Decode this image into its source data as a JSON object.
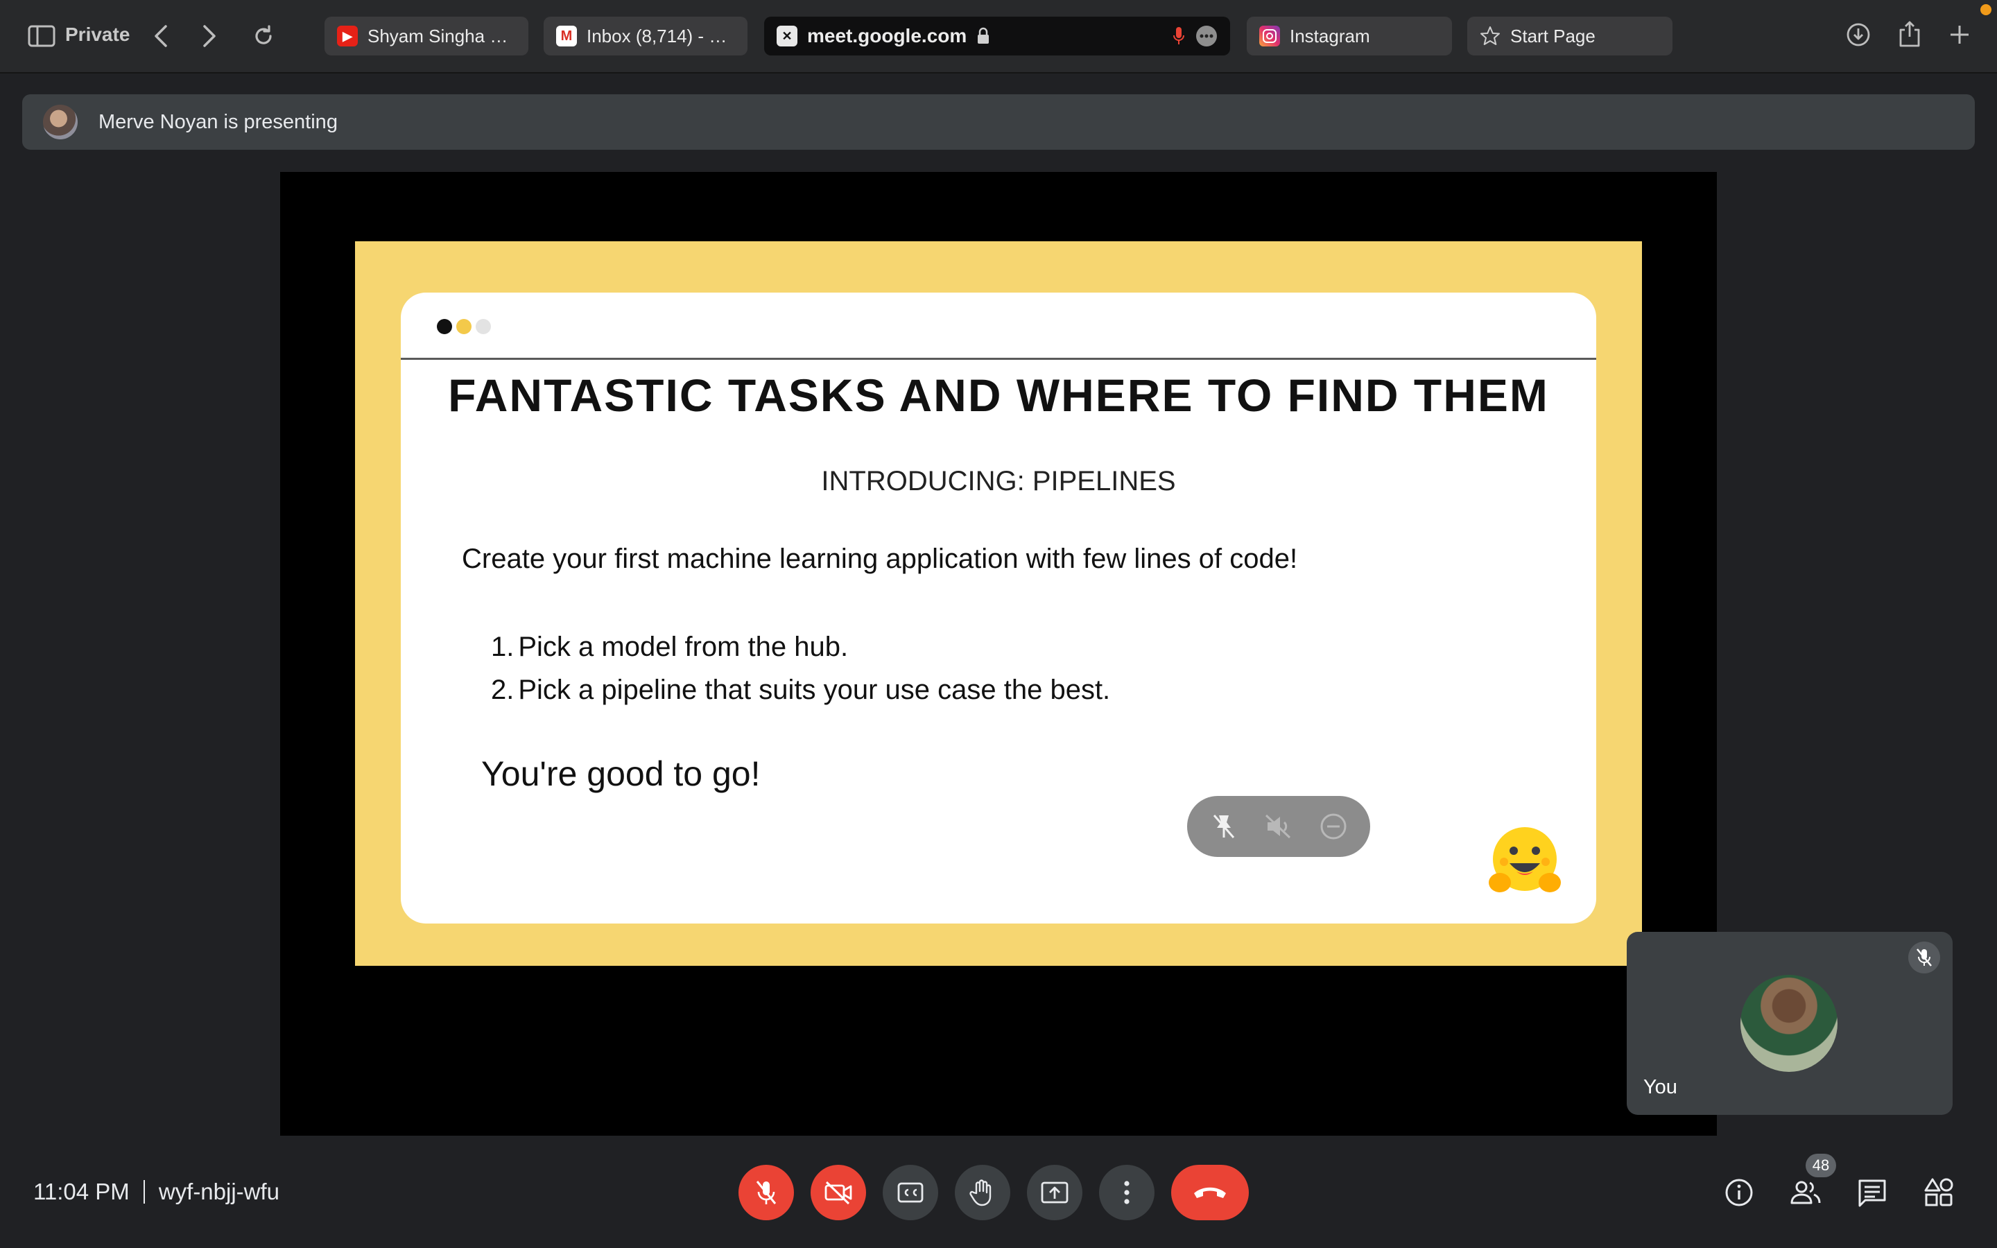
{
  "browser": {
    "private_label": "Private",
    "tabs": [
      {
        "label": "Shyam Singha Ro...",
        "icon": "youtube-icon",
        "active": false
      },
      {
        "label": "Inbox (8,714) - m...",
        "icon": "gmail-icon",
        "active": false
      },
      {
        "label": "meet.google.com",
        "icon": "meet-icon",
        "active": true
      },
      {
        "label": "Instagram",
        "icon": "instagram-icon",
        "active": false
      },
      {
        "label": "Start Page",
        "icon": "star-icon",
        "active": false
      }
    ]
  },
  "banner": {
    "text": "Merve Noyan is presenting"
  },
  "slide": {
    "title": "FANTASTIC TASKS AND WHERE TO FIND THEM",
    "subtitle": "INTRODUCING: PIPELINES",
    "line": "Create your first machine learning application with few lines of code!",
    "list": [
      {
        "num": "1.",
        "text": "Pick a model from the hub."
      },
      {
        "num": "2.",
        "text": "Pick a pipeline that suits your use case the best."
      }
    ],
    "closing": "You're good to go!",
    "dot_colors": [
      "#111111",
      "#f3c94a",
      "#e3e3e3"
    ],
    "emoji_icon": "hugging-face-emoji"
  },
  "self_tile": {
    "name": "You"
  },
  "bottom": {
    "time": "11:04 PM",
    "meeting_code": "wyf-nbjj-wfu",
    "participants_count": "48"
  },
  "colors": {
    "danger": "#ea4335",
    "slide_bg": "#f6d671",
    "control_grey": "#3c4043"
  }
}
